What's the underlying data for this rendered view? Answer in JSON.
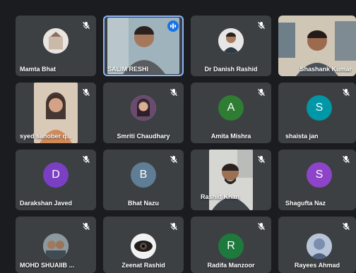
{
  "participants": [
    {
      "name": "Mamta Bhat",
      "muted": true,
      "tile": "photo-avatar"
    },
    {
      "name": "SALIM RESHI",
      "muted": false,
      "speaking": true,
      "tile": "video"
    },
    {
      "name": "Dr Danish Rashid",
      "muted": true,
      "tile": "photo-avatar"
    },
    {
      "name": "Shashank Kumar",
      "muted": false,
      "tile": "video"
    },
    {
      "name": "syed sanober q...",
      "muted": true,
      "tile": "video"
    },
    {
      "name": "Smriti Chaudhary",
      "muted": true,
      "tile": "photo-avatar"
    },
    {
      "name": "Amita Mishra",
      "muted": true,
      "tile": "letter-avatar",
      "initial": "A",
      "color": "#2e7d32"
    },
    {
      "name": "shaista jan",
      "muted": true,
      "tile": "letter-avatar",
      "initial": "S",
      "color": "#0097a7"
    },
    {
      "name": "Darakshan Javed",
      "muted": true,
      "tile": "letter-avatar",
      "initial": "D",
      "color": "#7b3fc4"
    },
    {
      "name": "Bhat Nazu",
      "muted": true,
      "tile": "letter-avatar",
      "initial": "B",
      "color": "#5f7d95"
    },
    {
      "name": "Rashid Khan",
      "muted": true,
      "tile": "video"
    },
    {
      "name": "Shagufta Naz",
      "muted": true,
      "tile": "letter-avatar",
      "initial": "S",
      "color": "#8e44c8"
    },
    {
      "name": "MOHD SHUAIIB ...",
      "muted": true,
      "tile": "photo-avatar"
    },
    {
      "name": "Zeenat Rashid",
      "muted": true,
      "tile": "photo-avatar"
    },
    {
      "name": "Radifa Manzoor",
      "muted": true,
      "tile": "letter-avatar",
      "initial": "R",
      "color": "#1e7a3c"
    },
    {
      "name": "Rayees Ahmad",
      "muted": true,
      "tile": "photo-avatar"
    }
  ],
  "colors": {
    "background": "#1b1c1f",
    "tile": "#3c4043",
    "speaking_outline": "#8ab4f8"
  }
}
